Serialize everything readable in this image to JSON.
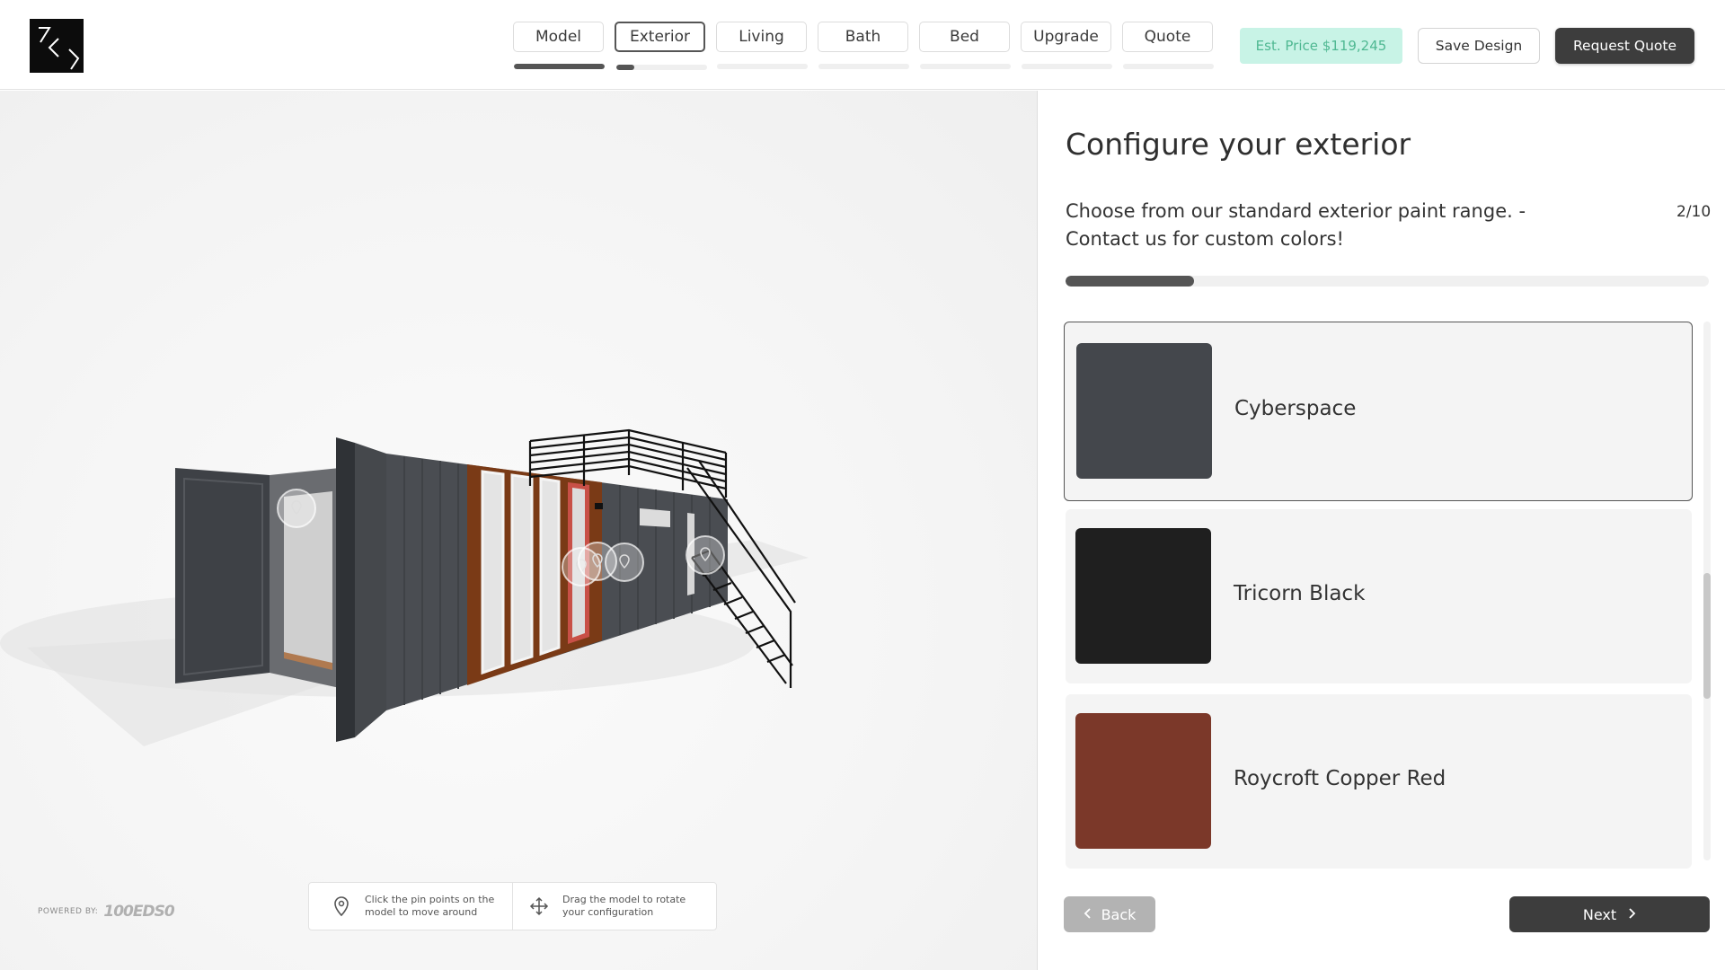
{
  "header": {
    "tabs": [
      {
        "label": "Model",
        "progress": 1.0
      },
      {
        "label": "Exterior",
        "progress": 0.2,
        "active": true
      },
      {
        "label": "Living",
        "progress": 0
      },
      {
        "label": "Bath",
        "progress": 0
      },
      {
        "label": "Bed",
        "progress": 0
      },
      {
        "label": "Upgrade",
        "progress": 0
      },
      {
        "label": "Quote",
        "progress": 0
      }
    ],
    "price_label": "Est. Price $119,245",
    "save_label": "Save Design",
    "quote_label": "Request Quote"
  },
  "viewer": {
    "powered_by_label": "POWERED BY:",
    "powered_by_brand": "100EDS0",
    "hint_pins": "Click the pin points on the model to move around",
    "hint_drag": "Drag the model to rotate your configuration"
  },
  "panel": {
    "title": "Configure your exterior",
    "description": "Choose from our standard exterior paint range. - Contact us for custom colors!",
    "step": "2/10",
    "step_progress": 0.2,
    "options": [
      {
        "name": "Cyberspace",
        "color": "#44474c",
        "selected": true
      },
      {
        "name": "Tricorn Black",
        "color": "#1f1f1f",
        "selected": false
      },
      {
        "name": "Roycroft Copper Red",
        "color": "#7b3829",
        "selected": false
      }
    ],
    "back_label": "Back",
    "next_label": "Next"
  }
}
